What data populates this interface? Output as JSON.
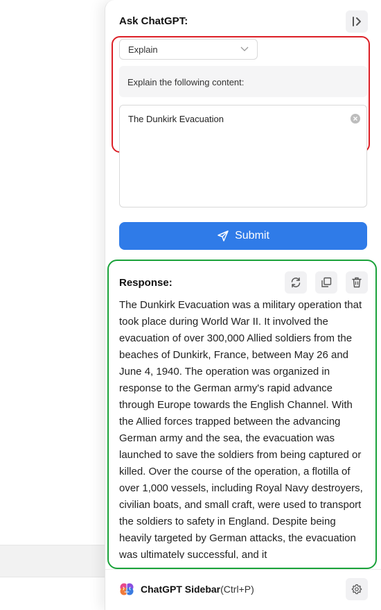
{
  "header": {
    "title": "Ask ChatGPT:"
  },
  "prompt": {
    "mode_selected": "Explain",
    "label": "Explain the following content:",
    "content_value": "The Dunkirk Evacuation"
  },
  "submit": {
    "label": "Submit"
  },
  "response": {
    "title": "Response:",
    "text": "The Dunkirk Evacuation was a military operation that took place during World War II. It involved the evacuation of over 300,000 Allied soldiers from the beaches of Dunkirk, France, between May 26 and June 4, 1940. The operation was organized in response to the German army's rapid advance through Europe towards the English Channel. With the Allied forces trapped between the advancing German army and the sea, the evacuation was launched to save the soldiers from being captured or killed. Over the course of the operation, a flotilla of over 1,000 vessels, including Royal Navy destroyers, civilian boats, and small craft, were used to transport the soldiers to safety in England. Despite being heavily targeted by German attacks, the evacuation was ultimately successful, and it"
  },
  "footer": {
    "brand": "ChatGPT Sidebar",
    "shortcut": "(Ctrl+P)"
  },
  "icons": {
    "collapse": "collapse-sidebar-icon",
    "dropdown": "chevron-down-icon",
    "clear": "clear-icon",
    "send": "send-icon",
    "regenerate": "refresh-icon",
    "copy": "copy-icon",
    "delete": "trash-icon",
    "logo": "brain-logo-icon",
    "settings": "gear-icon"
  },
  "colors": {
    "accent": "#2f7be8",
    "highlight_red": "#dc1f26",
    "highlight_green": "#1aa23a"
  }
}
